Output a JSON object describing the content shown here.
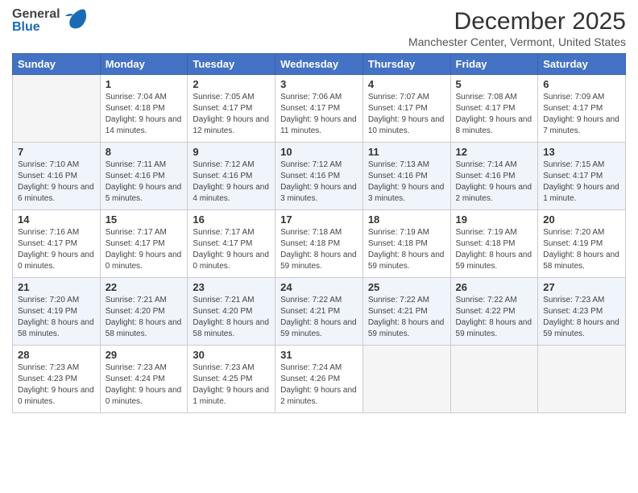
{
  "header": {
    "logo_general": "General",
    "logo_blue": "Blue",
    "month_title": "December 2025",
    "location": "Manchester Center, Vermont, United States"
  },
  "days_of_week": [
    "Sunday",
    "Monday",
    "Tuesday",
    "Wednesday",
    "Thursday",
    "Friday",
    "Saturday"
  ],
  "weeks": [
    [
      {
        "day": "",
        "empty": true
      },
      {
        "day": "1",
        "sunrise": "Sunrise: 7:04 AM",
        "sunset": "Sunset: 4:18 PM",
        "daylight": "Daylight: 9 hours and 14 minutes."
      },
      {
        "day": "2",
        "sunrise": "Sunrise: 7:05 AM",
        "sunset": "Sunset: 4:17 PM",
        "daylight": "Daylight: 9 hours and 12 minutes."
      },
      {
        "day": "3",
        "sunrise": "Sunrise: 7:06 AM",
        "sunset": "Sunset: 4:17 PM",
        "daylight": "Daylight: 9 hours and 11 minutes."
      },
      {
        "day": "4",
        "sunrise": "Sunrise: 7:07 AM",
        "sunset": "Sunset: 4:17 PM",
        "daylight": "Daylight: 9 hours and 10 minutes."
      },
      {
        "day": "5",
        "sunrise": "Sunrise: 7:08 AM",
        "sunset": "Sunset: 4:17 PM",
        "daylight": "Daylight: 9 hours and 8 minutes."
      },
      {
        "day": "6",
        "sunrise": "Sunrise: 7:09 AM",
        "sunset": "Sunset: 4:17 PM",
        "daylight": "Daylight: 9 hours and 7 minutes."
      }
    ],
    [
      {
        "day": "7",
        "sunrise": "Sunrise: 7:10 AM",
        "sunset": "Sunset: 4:16 PM",
        "daylight": "Daylight: 9 hours and 6 minutes."
      },
      {
        "day": "8",
        "sunrise": "Sunrise: 7:11 AM",
        "sunset": "Sunset: 4:16 PM",
        "daylight": "Daylight: 9 hours and 5 minutes."
      },
      {
        "day": "9",
        "sunrise": "Sunrise: 7:12 AM",
        "sunset": "Sunset: 4:16 PM",
        "daylight": "Daylight: 9 hours and 4 minutes."
      },
      {
        "day": "10",
        "sunrise": "Sunrise: 7:12 AM",
        "sunset": "Sunset: 4:16 PM",
        "daylight": "Daylight: 9 hours and 3 minutes."
      },
      {
        "day": "11",
        "sunrise": "Sunrise: 7:13 AM",
        "sunset": "Sunset: 4:16 PM",
        "daylight": "Daylight: 9 hours and 3 minutes."
      },
      {
        "day": "12",
        "sunrise": "Sunrise: 7:14 AM",
        "sunset": "Sunset: 4:16 PM",
        "daylight": "Daylight: 9 hours and 2 minutes."
      },
      {
        "day": "13",
        "sunrise": "Sunrise: 7:15 AM",
        "sunset": "Sunset: 4:17 PM",
        "daylight": "Daylight: 9 hours and 1 minute."
      }
    ],
    [
      {
        "day": "14",
        "sunrise": "Sunrise: 7:16 AM",
        "sunset": "Sunset: 4:17 PM",
        "daylight": "Daylight: 9 hours and 0 minutes."
      },
      {
        "day": "15",
        "sunrise": "Sunrise: 7:17 AM",
        "sunset": "Sunset: 4:17 PM",
        "daylight": "Daylight: 9 hours and 0 minutes."
      },
      {
        "day": "16",
        "sunrise": "Sunrise: 7:17 AM",
        "sunset": "Sunset: 4:17 PM",
        "daylight": "Daylight: 9 hours and 0 minutes."
      },
      {
        "day": "17",
        "sunrise": "Sunrise: 7:18 AM",
        "sunset": "Sunset: 4:18 PM",
        "daylight": "Daylight: 8 hours and 59 minutes."
      },
      {
        "day": "18",
        "sunrise": "Sunrise: 7:19 AM",
        "sunset": "Sunset: 4:18 PM",
        "daylight": "Daylight: 8 hours and 59 minutes."
      },
      {
        "day": "19",
        "sunrise": "Sunrise: 7:19 AM",
        "sunset": "Sunset: 4:18 PM",
        "daylight": "Daylight: 8 hours and 59 minutes."
      },
      {
        "day": "20",
        "sunrise": "Sunrise: 7:20 AM",
        "sunset": "Sunset: 4:19 PM",
        "daylight": "Daylight: 8 hours and 58 minutes."
      }
    ],
    [
      {
        "day": "21",
        "sunrise": "Sunrise: 7:20 AM",
        "sunset": "Sunset: 4:19 PM",
        "daylight": "Daylight: 8 hours and 58 minutes."
      },
      {
        "day": "22",
        "sunrise": "Sunrise: 7:21 AM",
        "sunset": "Sunset: 4:20 PM",
        "daylight": "Daylight: 8 hours and 58 minutes."
      },
      {
        "day": "23",
        "sunrise": "Sunrise: 7:21 AM",
        "sunset": "Sunset: 4:20 PM",
        "daylight": "Daylight: 8 hours and 58 minutes."
      },
      {
        "day": "24",
        "sunrise": "Sunrise: 7:22 AM",
        "sunset": "Sunset: 4:21 PM",
        "daylight": "Daylight: 8 hours and 59 minutes."
      },
      {
        "day": "25",
        "sunrise": "Sunrise: 7:22 AM",
        "sunset": "Sunset: 4:21 PM",
        "daylight": "Daylight: 8 hours and 59 minutes."
      },
      {
        "day": "26",
        "sunrise": "Sunrise: 7:22 AM",
        "sunset": "Sunset: 4:22 PM",
        "daylight": "Daylight: 8 hours and 59 minutes."
      },
      {
        "day": "27",
        "sunrise": "Sunrise: 7:23 AM",
        "sunset": "Sunset: 4:23 PM",
        "daylight": "Daylight: 8 hours and 59 minutes."
      }
    ],
    [
      {
        "day": "28",
        "sunrise": "Sunrise: 7:23 AM",
        "sunset": "Sunset: 4:23 PM",
        "daylight": "Daylight: 9 hours and 0 minutes."
      },
      {
        "day": "29",
        "sunrise": "Sunrise: 7:23 AM",
        "sunset": "Sunset: 4:24 PM",
        "daylight": "Daylight: 9 hours and 0 minutes."
      },
      {
        "day": "30",
        "sunrise": "Sunrise: 7:23 AM",
        "sunset": "Sunset: 4:25 PM",
        "daylight": "Daylight: 9 hours and 1 minute."
      },
      {
        "day": "31",
        "sunrise": "Sunrise: 7:24 AM",
        "sunset": "Sunset: 4:26 PM",
        "daylight": "Daylight: 9 hours and 2 minutes."
      },
      {
        "day": "",
        "empty": true
      },
      {
        "day": "",
        "empty": true
      },
      {
        "day": "",
        "empty": true
      }
    ]
  ]
}
